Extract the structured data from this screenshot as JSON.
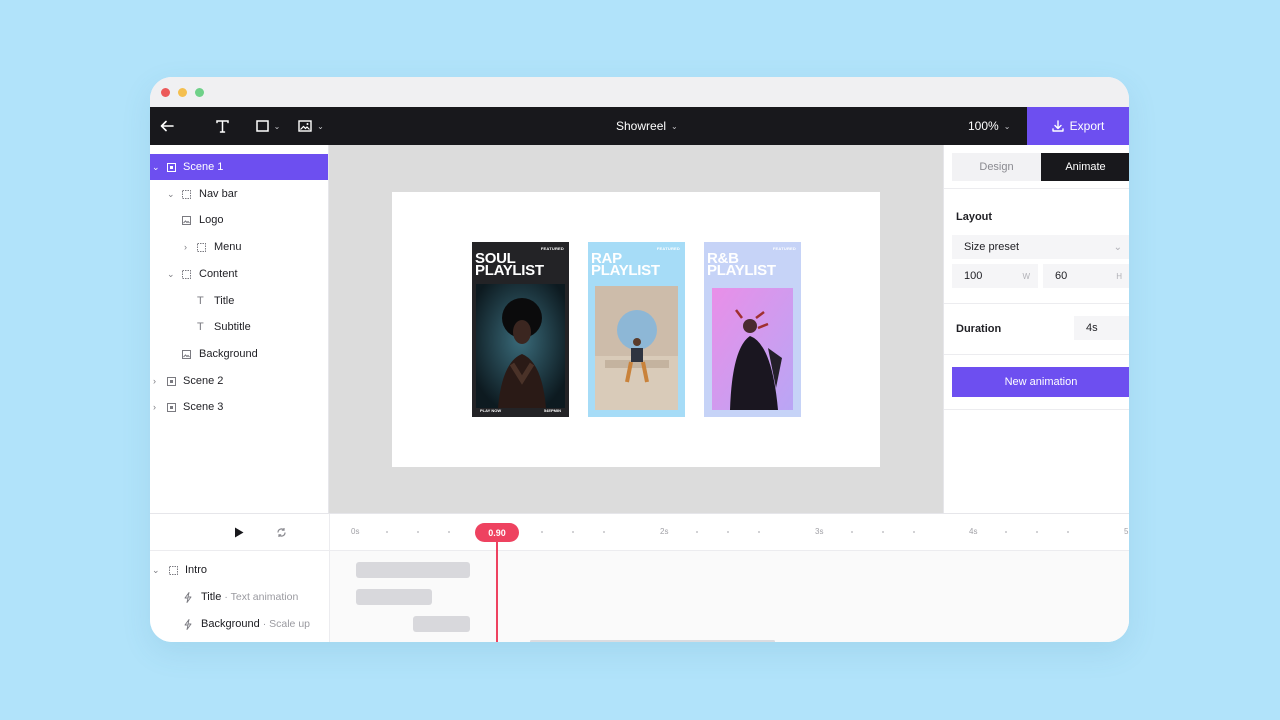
{
  "window": {
    "title_dots": {
      "close": "#ec5a5a",
      "minimize": "#f4bf4f",
      "zoom": "#6fd189"
    }
  },
  "toolbar": {
    "back_icon": "arrow-left-icon",
    "text_tool_icon": "text-tool-icon",
    "shape_tool_icon": "rectangle-tool-icon",
    "image_tool_icon": "image-tool-icon",
    "project_title": "Showreel",
    "zoom": "100%",
    "export_label": "Export",
    "export_color": "#6d4ff0"
  },
  "layers": [
    {
      "label": "Scene 1",
      "type": "scene",
      "expanded": true,
      "active": true
    },
    {
      "label": "Nav bar",
      "type": "group",
      "expanded": true
    },
    {
      "label": "Logo",
      "type": "image"
    },
    {
      "label": "Menu",
      "type": "group",
      "expanded": false
    },
    {
      "label": "Content",
      "type": "group",
      "expanded": true
    },
    {
      "label": "Title",
      "type": "text"
    },
    {
      "label": "Subtitle",
      "type": "text"
    },
    {
      "label": "Background",
      "type": "image"
    },
    {
      "label": "Scene 2",
      "type": "scene",
      "expanded": false
    },
    {
      "label": "Scene 3",
      "type": "scene",
      "expanded": false
    }
  ],
  "canvas": {
    "posters": [
      {
        "badge": "FEATURED",
        "title": "SOUL\nPLAYLIST",
        "bg": "#232326",
        "title_color": "#ffffff",
        "footer_left": "PLAY NOW",
        "footer_right": "54EPMIN",
        "footer_color": "#ffffff"
      },
      {
        "badge": "FEATURED",
        "title": "RAP\nPLAYLIST",
        "bg": "#a6dcf7",
        "title_color": "#ffffff",
        "footer_left": "",
        "footer_right": "",
        "footer_color": "#ffffff"
      },
      {
        "badge": "FEATURED",
        "title": "R&B\nPLAYLIST",
        "bg": "#c6d3f7",
        "title_color": "#ffffff",
        "footer_left": "",
        "footer_right": "",
        "footer_color": "#ffffff"
      }
    ]
  },
  "properties": {
    "tabs": [
      {
        "label": "Design",
        "active": false
      },
      {
        "label": "Animate",
        "active": true
      }
    ],
    "layout_label": "Layout",
    "size_preset": "Size preset",
    "width": "100",
    "width_unit": "W",
    "height": "60",
    "height_unit": "H",
    "duration_label": "Duration",
    "duration": "4s",
    "new_animation_label": "New animation"
  },
  "timeline": {
    "play_icon": "play-icon",
    "loop_icon": "loop-icon",
    "ruler_labels": [
      "0s",
      "2s",
      "3s",
      "4s",
      "5"
    ],
    "playhead": "0.90",
    "playhead_color": "#ee4260",
    "tracks": [
      {
        "label": "Intro",
        "sub": "",
        "type": "group"
      },
      {
        "label": "Title",
        "sub": "· Text animation",
        "type": "animation"
      },
      {
        "label": "Background",
        "sub": "· Scale up",
        "type": "animation"
      }
    ]
  }
}
